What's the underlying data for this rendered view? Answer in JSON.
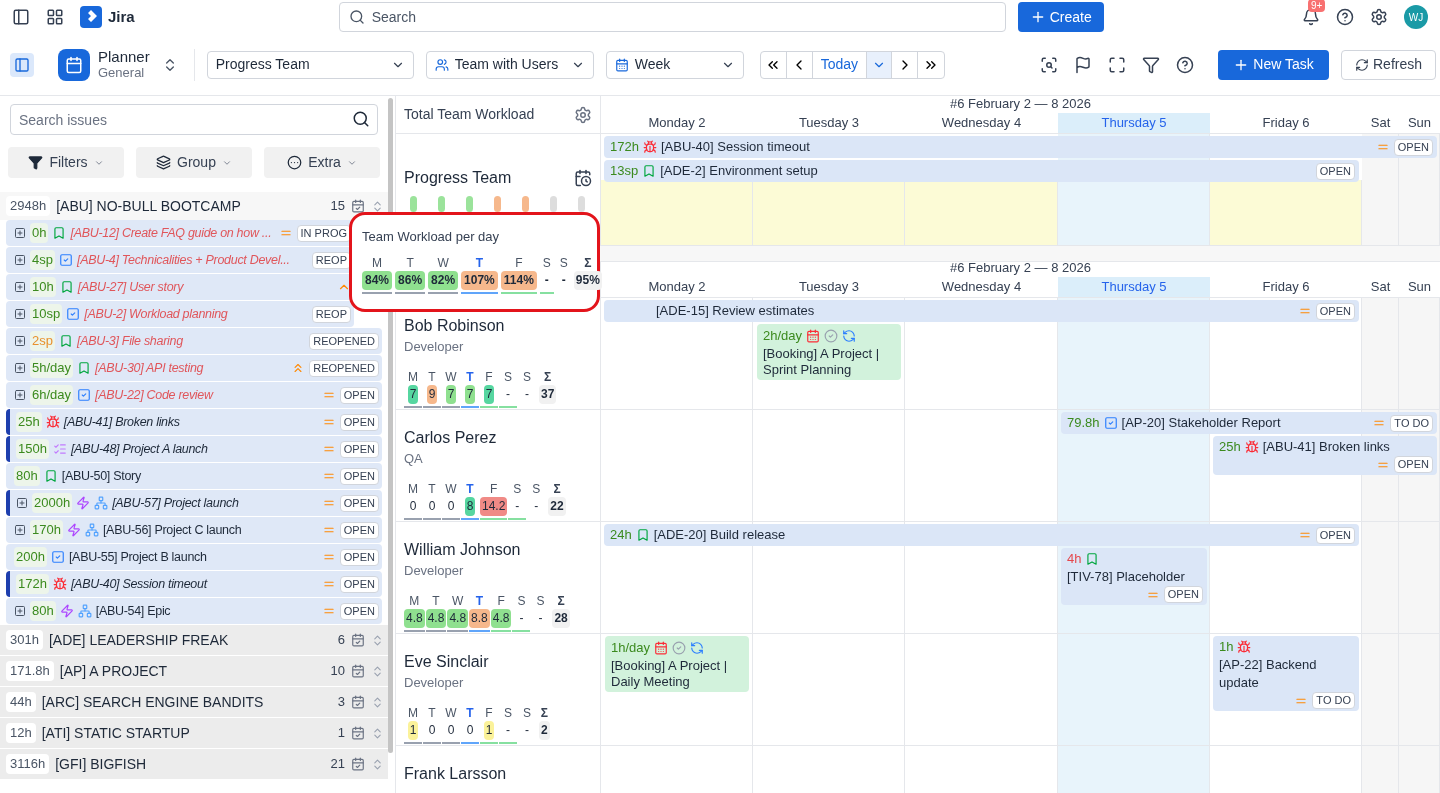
{
  "topbar": {
    "app_name": "Jira",
    "search": {
      "placeholder": "Search"
    },
    "create_label": "Create",
    "notification_badge": "9+",
    "avatar": "WJ"
  },
  "toolbar": {
    "planner_title": "Planner",
    "planner_subtitle": "General",
    "team_select": "Progress Team",
    "view_select": "Team with Users",
    "period_select": "Week",
    "today_label": "Today",
    "new_task_label": "New Task",
    "refresh_label": "Refresh"
  },
  "sidebar": {
    "search": {
      "placeholder": "Search issues"
    },
    "buttons": [
      {
        "kind": "filter",
        "label": "Filters"
      },
      {
        "kind": "group",
        "label": "Group"
      },
      {
        "kind": "extra",
        "label": "Extra"
      }
    ],
    "groups": [
      {
        "hours": "2948h",
        "title": "[ABU] NO-BULL BOOTCAMP",
        "count": "15",
        "expanded": true,
        "issues": [
          {
            "expandable": true,
            "hours": "0h",
            "warn": false,
            "kind": "story",
            "hierarchy": false,
            "text": "[ABU-12] Create FAQ guide on how ...",
            "late": true,
            "unscheduled": true,
            "priority": {
              "kind": "medium"
            },
            "status": "IN PROG",
            "accent": false,
            "under_popup": true
          },
          {
            "expandable": true,
            "hours": "4sp",
            "warn": false,
            "kind": "task",
            "hierarchy": false,
            "text": "[ABU-4] Technicalities + Product Devel...",
            "late": true,
            "unscheduled": true,
            "status": "REOP",
            "accent": false,
            "under_popup": true
          },
          {
            "expandable": true,
            "hours": "10h",
            "warn": false,
            "kind": "story",
            "hierarchy": false,
            "text": "[ABU-27] User story",
            "late": true,
            "unscheduled": true,
            "priority": {
              "kind": "high"
            },
            "accent": false,
            "under_popup": true
          },
          {
            "expandable": true,
            "hours": "10sp",
            "warn": false,
            "kind": "task",
            "hierarchy": false,
            "text": "[ABU-2] Workload planning",
            "late": true,
            "unscheduled": true,
            "status": "REOP",
            "accent": false,
            "under_popup": true
          },
          {
            "expandable": true,
            "hours": "2sp",
            "warn": true,
            "kind": "story",
            "hierarchy": false,
            "text": "[ABU-3] File sharing",
            "late": true,
            "unscheduled": true,
            "status": "REOPENED",
            "accent": false,
            "under_popup": false
          },
          {
            "expandable": true,
            "hours": "5h/day",
            "warn": false,
            "kind": "story",
            "hierarchy": false,
            "text": "[ABU-30] API testing",
            "late": true,
            "unscheduled": true,
            "priority": {
              "kind": "highest"
            },
            "status": "REOPENED",
            "accent": false,
            "under_popup": false
          },
          {
            "expandable": true,
            "hours": "6h/day",
            "warn": false,
            "kind": "task",
            "hierarchy": false,
            "text": "[ABU-22] Code review",
            "late": true,
            "unscheduled": true,
            "priority": {
              "kind": "medium"
            },
            "status": "OPEN",
            "accent": false,
            "under_popup": false
          },
          {
            "expandable": false,
            "hours": "25h",
            "warn": false,
            "kind": "bug",
            "hierarchy": false,
            "text": "[ABU-41] Broken links",
            "late": false,
            "unscheduled": true,
            "priority": {
              "kind": "medium"
            },
            "status": "OPEN",
            "accent": true,
            "under_popup": false
          },
          {
            "expandable": false,
            "hours": "150h",
            "warn": false,
            "kind": "subtasks",
            "hierarchy": false,
            "text": "[ABU-48] Project A launch",
            "late": false,
            "unscheduled": true,
            "priority": {
              "kind": "medium"
            },
            "status": "OPEN",
            "accent": true,
            "under_popup": false
          },
          {
            "expandable": false,
            "hours": "80h",
            "warn": false,
            "kind": "story",
            "hierarchy": false,
            "text": "[ABU-50] Story",
            "late": false,
            "unscheduled": false,
            "priority": {
              "kind": "medium"
            },
            "status": "OPEN",
            "accent": false,
            "under_popup": false
          },
          {
            "expandable": true,
            "hours": "2000h",
            "warn": false,
            "kind": "epic",
            "hierarchy": true,
            "text": "[ABU-57] Project launch",
            "late": false,
            "unscheduled": true,
            "priority": {
              "kind": "medium"
            },
            "status": "OPEN",
            "accent": true,
            "under_popup": false
          },
          {
            "expandable": true,
            "hours": "170h",
            "warn": false,
            "kind": "epic",
            "hierarchy": true,
            "text": "[ABU-56] Project C launch",
            "late": false,
            "unscheduled": false,
            "priority": {
              "kind": "medium"
            },
            "status": "OPEN",
            "accent": false,
            "under_popup": false
          },
          {
            "expandable": false,
            "hours": "200h",
            "warn": false,
            "kind": "task",
            "hierarchy": false,
            "text": "[ABU-55] Project B launch",
            "late": false,
            "unscheduled": false,
            "priority": {
              "kind": "medium"
            },
            "status": "OPEN",
            "accent": false,
            "under_popup": false
          },
          {
            "expandable": false,
            "hours": "172h",
            "warn": false,
            "kind": "bug",
            "hierarchy": false,
            "text": "[ABU-40] Session timeout",
            "late": false,
            "unscheduled": true,
            "priority": {
              "kind": "medium"
            },
            "status": "OPEN",
            "accent": true,
            "under_popup": false
          },
          {
            "expandable": true,
            "hours": "80h",
            "warn": false,
            "kind": "epic",
            "hierarchy": true,
            "text": "[ABU-54] Epic",
            "late": false,
            "unscheduled": false,
            "priority": {
              "kind": "medium"
            },
            "status": "OPEN",
            "accent": false,
            "under_popup": false
          }
        ]
      },
      {
        "hours": "301h",
        "title": "[ADE] LEADERSHIP FREAK",
        "count": "6",
        "expanded": false
      },
      {
        "hours": "171.8h",
        "title": "[AP] A PROJECT",
        "count": "10",
        "expanded": false
      },
      {
        "hours": "44h",
        "title": "[ARC] SEARCH ENGINE BANDITS",
        "count": "3",
        "expanded": false
      },
      {
        "hours": "12h",
        "title": "[ATI] STATIC STARTUP",
        "count": "1",
        "expanded": false
      },
      {
        "hours": "3116h",
        "title": "[GFI] BIGFISH",
        "count": "21",
        "expanded": false
      }
    ]
  },
  "workload": {
    "title": "Total Team Workload",
    "team": {
      "name": "Progress Team",
      "bars": [
        {
          "color": "#9be39b"
        },
        {
          "color": "#9be39b"
        },
        {
          "color": "#9be39b"
        },
        {
          "color": "#f6b88c"
        },
        {
          "color": "#f6b88c"
        },
        {
          "color": "#dddddd"
        },
        {
          "color": "#dddddd"
        }
      ]
    },
    "popup": {
      "title": "Team Workload per day",
      "days": [
        {
          "label": "M",
          "value": "84%",
          "color": "#8fe08f",
          "today": false
        },
        {
          "label": "T",
          "value": "86%",
          "color": "#8fe08f",
          "today": false
        },
        {
          "label": "W",
          "value": "82%",
          "color": "#8fe08f",
          "today": false
        },
        {
          "label": "T",
          "value": "107%",
          "color": "#f6b88c",
          "today": true
        },
        {
          "label": "F",
          "value": "114%",
          "color": "#f6b88c",
          "today": false
        },
        {
          "label": "S",
          "value": "-",
          "today": false
        },
        {
          "label": "S",
          "value": "-",
          "today": false
        }
      ],
      "total_label": "Σ",
      "total": "95%"
    },
    "people": [
      {
        "name": "Bob Robinson",
        "role": "Developer",
        "days": [
          {
            "label": "M",
            "value": "7",
            "color": "#56d6a0",
            "today": false
          },
          {
            "label": "T",
            "value": "9",
            "color": "#f6b88c",
            "today": false
          },
          {
            "label": "W",
            "value": "7",
            "color": "#8fe08f",
            "today": false
          },
          {
            "label": "T",
            "value": "7",
            "color": "#8fe08f",
            "today": true
          },
          {
            "label": "F",
            "value": "7",
            "color": "#56d6a0",
            "today": false
          },
          {
            "label": "S",
            "value": "-",
            "today": false
          },
          {
            "label": "S",
            "value": "-",
            "today": false
          }
        ],
        "total_label": "Σ",
        "total": "37"
      },
      {
        "name": "Carlos Perez",
        "role": "QA",
        "days": [
          {
            "label": "M",
            "value": "0",
            "today": false
          },
          {
            "label": "T",
            "value": "0",
            "today": false
          },
          {
            "label": "W",
            "value": "0",
            "today": false
          },
          {
            "label": "T",
            "value": "8",
            "color": "#56d6a0",
            "today": true
          },
          {
            "label": "F",
            "value": "14.2",
            "color": "#f08a86",
            "today": false
          },
          {
            "label": "S",
            "value": "-",
            "today": false
          },
          {
            "label": "S",
            "value": "-",
            "today": false
          }
        ],
        "total_label": "Σ",
        "total": "22"
      },
      {
        "name": "William Johnson",
        "role": "Developer",
        "days": [
          {
            "label": "M",
            "value": "4.8",
            "color": "#8fe08f",
            "today": false
          },
          {
            "label": "T",
            "value": "4.8",
            "color": "#8fe08f",
            "today": false
          },
          {
            "label": "W",
            "value": "4.8",
            "color": "#8fe08f",
            "today": false
          },
          {
            "label": "T",
            "value": "8.8",
            "color": "#f6b88c",
            "today": true
          },
          {
            "label": "F",
            "value": "4.8",
            "color": "#8fe08f",
            "today": false
          },
          {
            "label": "S",
            "value": "-",
            "today": false
          },
          {
            "label": "S",
            "value": "-",
            "today": false
          }
        ],
        "total_label": "Σ",
        "total": "28"
      },
      {
        "name": "Eve Sinclair",
        "role": "Developer",
        "days": [
          {
            "label": "M",
            "value": "1",
            "color": "#fbf29a",
            "today": false
          },
          {
            "label": "T",
            "value": "0",
            "today": false
          },
          {
            "label": "W",
            "value": "0",
            "today": false
          },
          {
            "label": "T",
            "value": "0",
            "today": true
          },
          {
            "label": "F",
            "value": "1",
            "color": "#fbf29a",
            "today": false
          },
          {
            "label": "S",
            "value": "-",
            "today": false
          },
          {
            "label": "S",
            "value": "-",
            "today": false
          }
        ],
        "total_label": "Σ",
        "total": "2"
      },
      {
        "name": "Frank Larsson"
      }
    ]
  },
  "calendar": {
    "sections": [
      {
        "kind": "team",
        "week_title": "#6 February 2 — 8 2026",
        "days": [
          {
            "label": "Monday 2",
            "today": false
          },
          {
            "label": "Tuesday 3",
            "today": false
          },
          {
            "label": "Wednesday 4",
            "today": false
          },
          {
            "label": "Thursday 5",
            "today": true
          },
          {
            "label": "Friday 6",
            "today": false
          },
          {
            "label": "Sat",
            "today": false
          },
          {
            "label": "Sun",
            "today": false
          }
        ],
        "rows": [
          {
            "lanes": [
              [
                {
                  "kind": "issue",
                  "from": {
                    "kind": "mon"
                  },
                  "to": {
                    "kind": "sun"
                  },
                  "hours": "172h",
                  "late": false,
                  "icon": {
                    "kind": "bug"
                  },
                  "text": "[ABU-40] Session timeout",
                  "priority": {
                    "kind": "medium"
                  },
                  "status": "OPEN",
                  "under_popup": false
                }
              ],
              [
                {
                  "kind": "issue",
                  "from": {
                    "kind": "mon"
                  },
                  "to": {
                    "kind": "fri"
                  },
                  "hours": "13sp",
                  "late": false,
                  "icon": {
                    "kind": "story"
                  },
                  "text": "[ADE-2] Environment setup",
                  "status": "OPEN",
                  "under_popup": false
                }
              ]
            ]
          }
        ]
      },
      {
        "kind": "people",
        "week_title": "#6 February 2 — 8 2026",
        "days": [
          {
            "label": "Monday 2",
            "today": false
          },
          {
            "label": "Tuesday 3",
            "today": false
          },
          {
            "label": "Wednesday 4",
            "today": false
          },
          {
            "label": "Thursday 5",
            "today": true
          },
          {
            "label": "Friday 6",
            "today": false
          },
          {
            "label": "Sat",
            "today": false
          },
          {
            "label": "Sun",
            "today": false
          }
        ],
        "rows": [
          {
            "lanes": [
              [
                {
                  "kind": "issue",
                  "from": {
                    "kind": "mon"
                  },
                  "to": {
                    "kind": "fri"
                  },
                  "text": "[ADE-15] Review estimates",
                  "priority": {
                    "kind": "medium"
                  },
                  "status": "OPEN",
                  "under_popup": true
                }
              ],
              [
                {
                  "kind": "booking",
                  "from": {
                    "kind": "tue"
                  },
                  "to": {
                    "kind": "tue"
                  },
                  "hours": "2h/day",
                  "text": "[Booking] A Project | Sprint Planning"
                }
              ]
            ]
          },
          {
            "lanes": [
              [
                {
                  "kind": "issue",
                  "from": {
                    "kind": "thu"
                  },
                  "to": {
                    "kind": "sun"
                  },
                  "hours": "79.8h",
                  "late": false,
                  "icon": {
                    "kind": "task"
                  },
                  "text": "[AP-20] Stakeholder Report",
                  "priority": {
                    "kind": "medium"
                  },
                  "status": "TO DO",
                  "under_popup": false
                }
              ],
              [
                {
                  "kind": "issue",
                  "from": {
                    "kind": "fri"
                  },
                  "to": {
                    "kind": "sun"
                  },
                  "hours": "25h",
                  "late": false,
                  "icon": {
                    "kind": "bug"
                  },
                  "text": "[ABU-41] Broken links",
                  "priority": {
                    "kind": "medium"
                  },
                  "status": "OPEN",
                  "under_popup": false
                }
              ]
            ]
          },
          {
            "lanes": [
              [
                {
                  "kind": "issue",
                  "from": {
                    "kind": "mon"
                  },
                  "to": {
                    "kind": "fri"
                  },
                  "hours": "24h",
                  "late": false,
                  "icon": {
                    "kind": "story"
                  },
                  "text": "[ADE-20] Build release",
                  "priority": {
                    "kind": "medium"
                  },
                  "status": "OPEN",
                  "under_popup": false
                }
              ],
              [
                {
                  "kind": "issue",
                  "from": {
                    "kind": "thu"
                  },
                  "to": {
                    "kind": "thu"
                  },
                  "hours": "4h",
                  "late": true,
                  "icon": {
                    "kind": "story"
                  },
                  "text": "[TIV-78] Placeholder",
                  "priority": {
                    "kind": "medium"
                  },
                  "status": "OPEN",
                  "under_popup": false
                }
              ]
            ]
          },
          {
            "lanes": [
              [
                {
                  "kind": "booking",
                  "from": {
                    "kind": "mon"
                  },
                  "to": {
                    "kind": "mon"
                  },
                  "hours": "1h/day",
                  "text": "[Booking] A Project | Daily Meeting"
                },
                {
                  "kind": "issue",
                  "from": {
                    "kind": "fri"
                  },
                  "to": {
                    "kind": "fri"
                  },
                  "hours": "1h",
                  "late": false,
                  "icon": {
                    "kind": "bug"
                  },
                  "text": "[AP-22] Backend update",
                  "priority": {
                    "kind": "medium"
                  },
                  "status": "TO DO",
                  "under_popup": false
                }
              ]
            ]
          }
        ]
      }
    ]
  }
}
